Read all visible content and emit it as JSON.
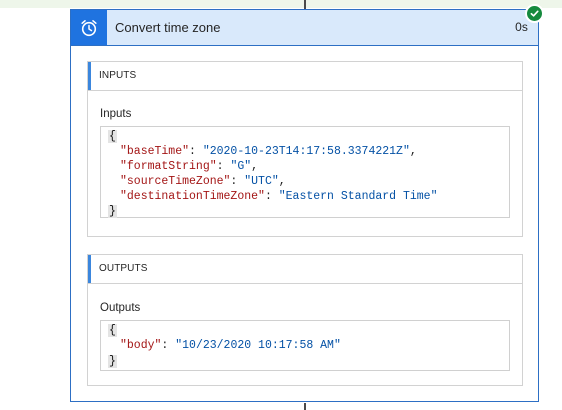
{
  "card": {
    "title": "Convert time zone",
    "duration": "0s",
    "status": "succeeded",
    "accent_color": "#1f73e0",
    "success_color": "#158a3e"
  },
  "inputs": {
    "section_title": "INPUTS",
    "label": "Inputs",
    "open_brace": "{",
    "close_brace": "}",
    "lines": [
      {
        "key": "\"baseTime\"",
        "value": "\"2020-10-23T14:17:58.3374221Z\"",
        "sep": ","
      },
      {
        "key": "\"formatString\"",
        "value": "\"G\"",
        "sep": ","
      },
      {
        "key": "\"sourceTimeZone\"",
        "value": "\"UTC\"",
        "sep": ","
      },
      {
        "key": "\"destinationTimeZone\"",
        "value": "\"Eastern Standard Time\"",
        "sep": ""
      }
    ]
  },
  "outputs": {
    "section_title": "OUTPUTS",
    "label": "Outputs",
    "open_brace": "{",
    "close_brace": "}",
    "lines": [
      {
        "key": "\"body\"",
        "value": "\"10/23/2020 10:17:58 AM\"",
        "sep": ""
      }
    ]
  }
}
